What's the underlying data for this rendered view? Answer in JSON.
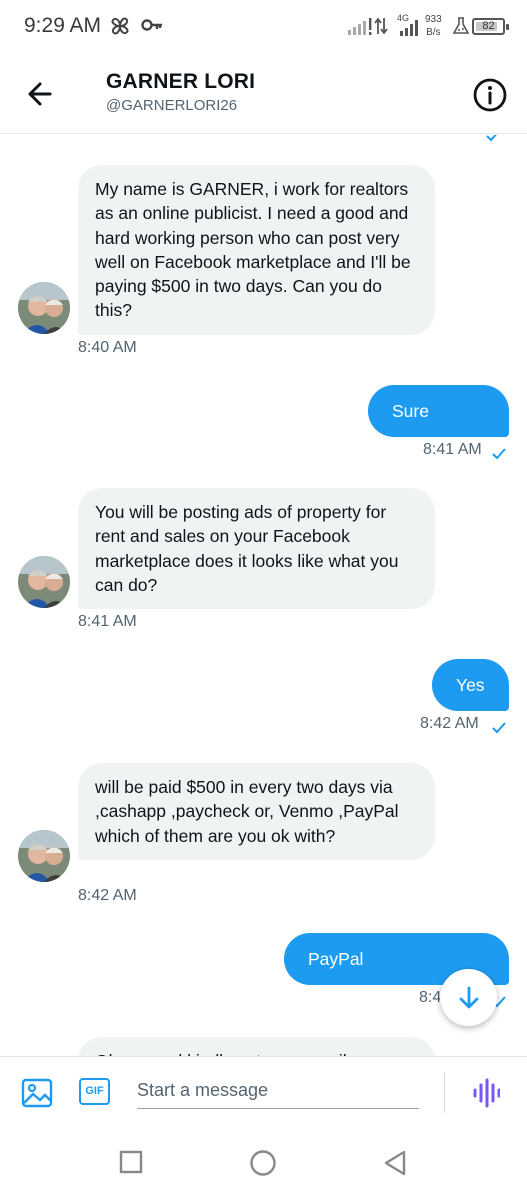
{
  "status_bar": {
    "time": "9:29 AM",
    "network_type": "4G",
    "speed_value": "933",
    "speed_unit": "B/s",
    "battery_level": "82",
    "battery_fraction": 0.82,
    "icons": [
      "pinwheel-icon",
      "key-icon",
      "signal-icon",
      "signal-icon",
      "flask-icon",
      "battery-icon"
    ]
  },
  "header": {
    "name": "GARNER LORI",
    "handle": "@GARNERLORI26",
    "back_icon": "arrow-left-icon",
    "info_icon": "info-icon"
  },
  "messages": [
    {
      "direction": "received",
      "text": "My name is  GARNER, i work for realtors as an online publicist. I need a good and hard working person who can post very well on Facebook marketplace and I'll be paying $500 in two  days. Can you do this?",
      "time": "8:40 AM"
    },
    {
      "direction": "sent",
      "text": "Sure",
      "time": "8:41 AM"
    },
    {
      "direction": "received",
      "text": "You will be posting ads of property for rent and sales on your Facebook marketplace does it looks like what you can do?",
      "time": "8:41 AM"
    },
    {
      "direction": "sent",
      "text": "Yes",
      "time": "8:42 AM"
    },
    {
      "direction": "received",
      "text": "will be paid $500 in every two  days via  ,cashapp ,paycheck or, Venmo ,PayPal which of them are you ok with?",
      "time": "8:42 AM"
    },
    {
      "direction": "sent",
      "text": "PayPal",
      "time": "8:4"
    },
    {
      "direction": "received",
      "text": "Okay. send kindly out your email",
      "time": ""
    }
  ],
  "composer": {
    "placeholder": "Start a message",
    "gif_label": "GIF",
    "icons": [
      "image-icon",
      "gif-icon",
      "voice-icon"
    ]
  },
  "nav": {
    "icons": [
      "square-icon",
      "circle-icon",
      "triangle-icon"
    ]
  },
  "colors": {
    "accent": "#1d9bf0",
    "received_bubble": "#eff3f4",
    "voice": "#7856ff"
  }
}
